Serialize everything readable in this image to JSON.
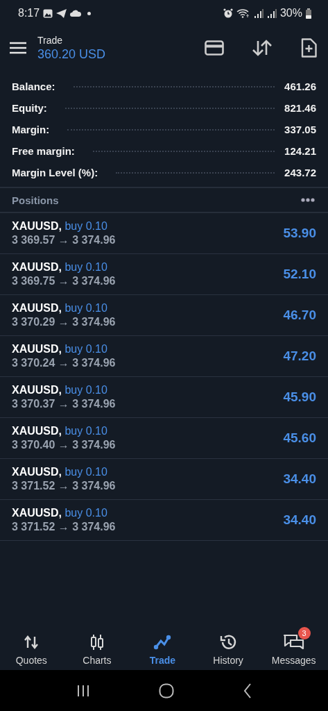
{
  "status_bar": {
    "time": "8:17",
    "battery": "30%"
  },
  "header": {
    "title": "Trade",
    "balance": "360.20 USD"
  },
  "summary": [
    {
      "label": "Balance:",
      "value": "461.26"
    },
    {
      "label": "Equity:",
      "value": "821.46"
    },
    {
      "label": "Margin:",
      "value": "337.05"
    },
    {
      "label": "Free margin:",
      "value": "124.21"
    },
    {
      "label": "Margin Level (%):",
      "value": "243.72"
    }
  ],
  "positions_title": "Positions",
  "positions": [
    {
      "symbol": "XAUUSD,",
      "side": "buy",
      "volume": "0.10",
      "prices": "3 369.57 → 3 374.96",
      "profit": "53.90"
    },
    {
      "symbol": "XAUUSD,",
      "side": "buy",
      "volume": "0.10",
      "prices": "3 369.75 → 3 374.96",
      "profit": "52.10"
    },
    {
      "symbol": "XAUUSD,",
      "side": "buy",
      "volume": "0.10",
      "prices": "3 370.29 → 3 374.96",
      "profit": "46.70"
    },
    {
      "symbol": "XAUUSD,",
      "side": "buy",
      "volume": "0.10",
      "prices": "3 370.24 → 3 374.96",
      "profit": "47.20"
    },
    {
      "symbol": "XAUUSD,",
      "side": "buy",
      "volume": "0.10",
      "prices": "3 370.37 → 3 374.96",
      "profit": "45.90"
    },
    {
      "symbol": "XAUUSD,",
      "side": "buy",
      "volume": "0.10",
      "prices": "3 370.40 → 3 374.96",
      "profit": "45.60"
    },
    {
      "symbol": "XAUUSD,",
      "side": "buy",
      "volume": "0.10",
      "prices": "3 371.52 → 3 374.96",
      "profit": "34.40"
    },
    {
      "symbol": "XAUUSD,",
      "side": "buy",
      "volume": "0.10",
      "prices": "3 371.52 → 3 374.96",
      "profit": "34.40"
    }
  ],
  "nav": [
    {
      "kind": "quotes",
      "label": "Quotes",
      "selected": false
    },
    {
      "kind": "charts",
      "label": "Charts",
      "selected": false
    },
    {
      "kind": "trade",
      "label": "Trade",
      "selected": true
    },
    {
      "kind": "history",
      "label": "History",
      "selected": false
    },
    {
      "kind": "messages",
      "label": "Messages",
      "selected": false,
      "badge": "3"
    }
  ]
}
